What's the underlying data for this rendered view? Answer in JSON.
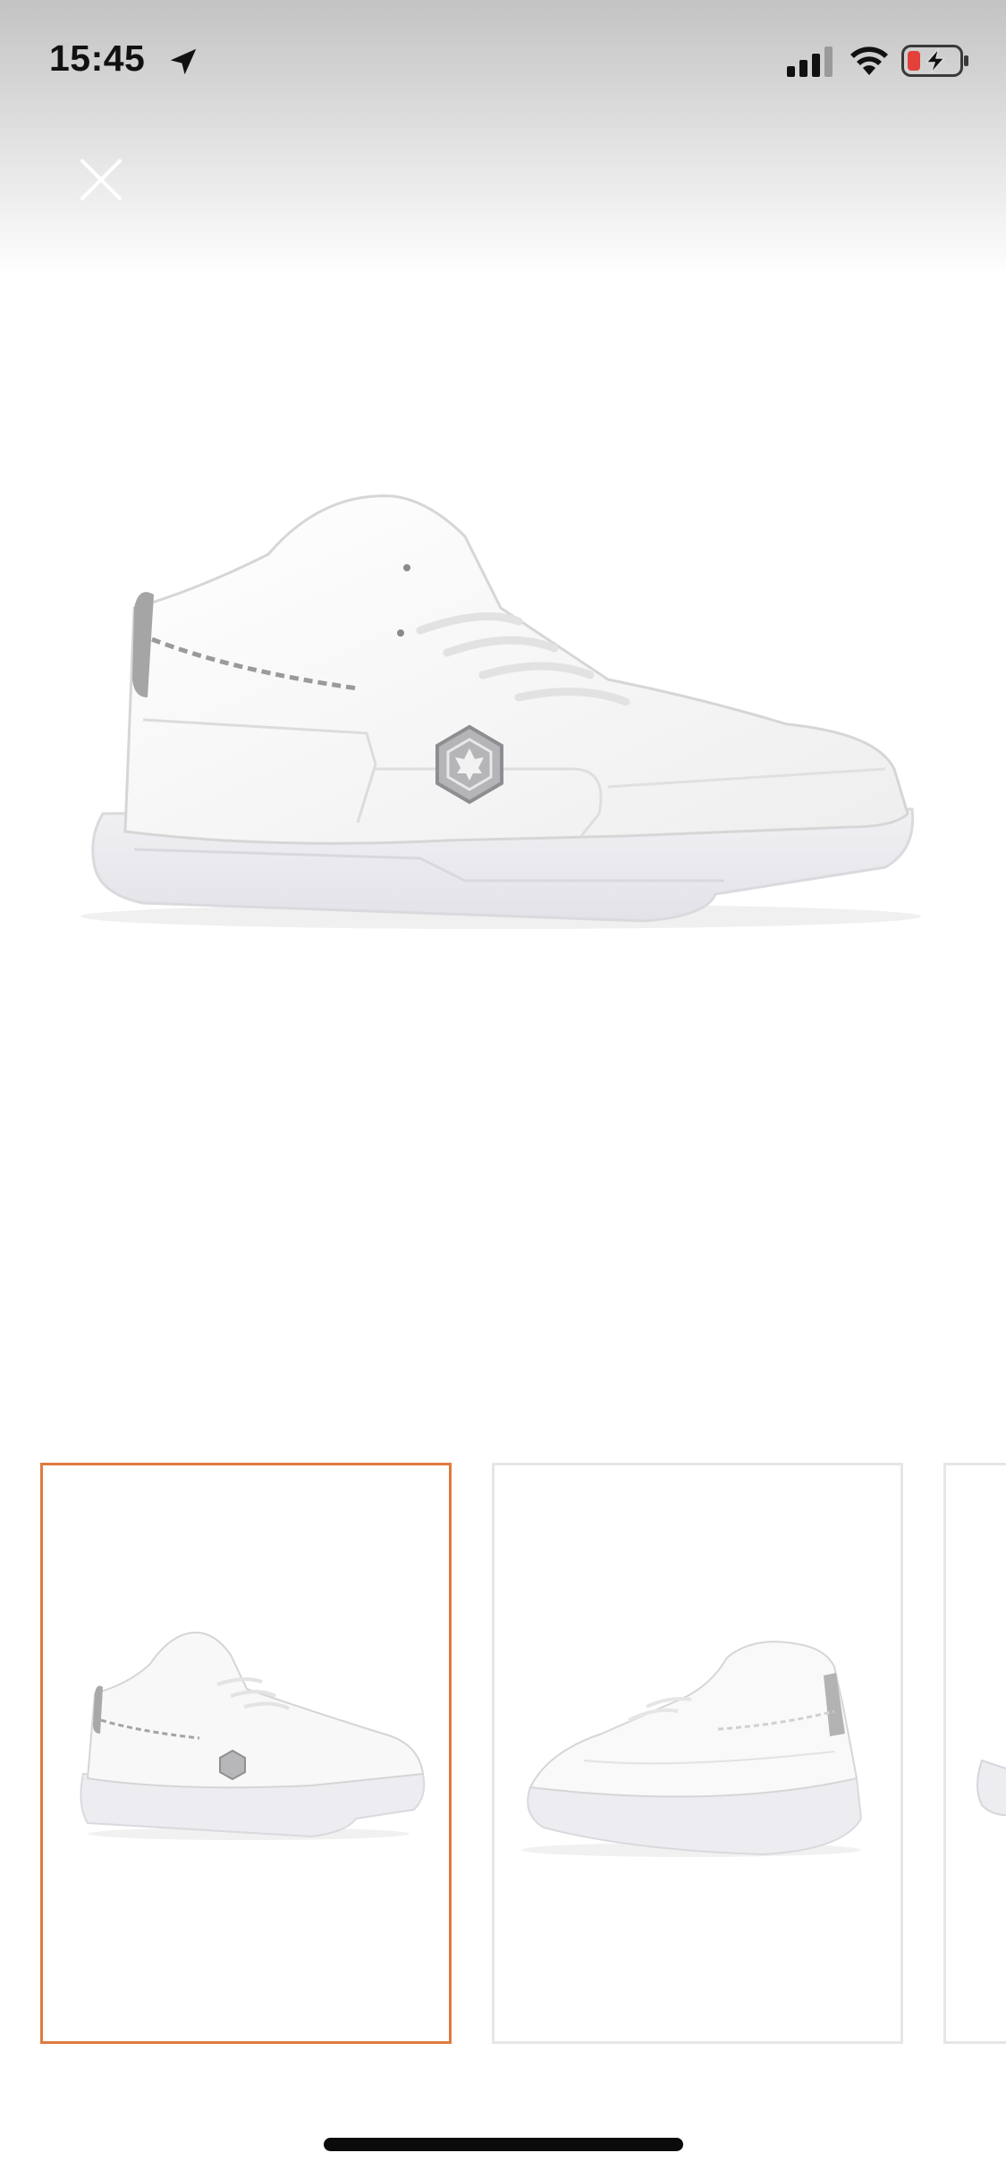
{
  "status_bar": {
    "time": "15:45",
    "icons": [
      "location-arrow-icon",
      "cellular-signal-icon",
      "wifi-icon",
      "battery-charging-icon"
    ],
    "battery_color": "#e3413a"
  },
  "header": {
    "close_icon": "close-icon"
  },
  "gallery": {
    "hero": "white-mid-top-sneaker-side-view",
    "thumbnails": [
      {
        "view": "side-view",
        "selected": true
      },
      {
        "view": "back-angle-view",
        "selected": false
      },
      {
        "view": "partial-next-view",
        "selected": false
      }
    ],
    "selected_border_color": "#e07a3f"
  }
}
